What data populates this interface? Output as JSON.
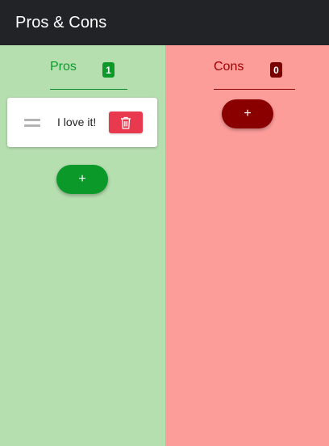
{
  "app": {
    "title": "Pros & Cons"
  },
  "pros": {
    "title": "Pros",
    "count": "1",
    "items": [
      {
        "text": "I love it!"
      }
    ],
    "add_label": "+",
    "delete_icon": "trash-icon",
    "color": "#0b9a2a",
    "background": "#b6dfb0"
  },
  "cons": {
    "title": "Cons",
    "count": "0",
    "items": [],
    "add_label": "+",
    "color": "#8a0000",
    "background": "#fd9d9a"
  }
}
